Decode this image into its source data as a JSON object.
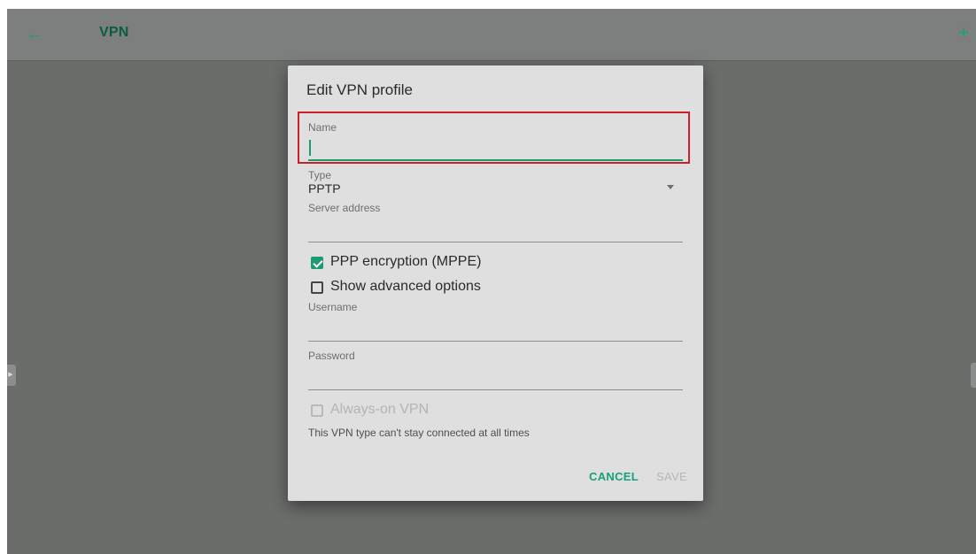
{
  "appbar": {
    "title": "VPN",
    "back_icon": "arrow-left-icon",
    "add_icon": "plus-icon",
    "back_glyph": "←",
    "add_glyph": "+"
  },
  "dialog": {
    "title": "Edit VPN profile",
    "fields": {
      "name": {
        "label": "Name",
        "value": ""
      },
      "type": {
        "label": "Type",
        "value": "PPTP"
      },
      "server_address": {
        "label": "Server address",
        "value": ""
      },
      "username": {
        "label": "Username",
        "value": ""
      },
      "password": {
        "label": "Password",
        "value": ""
      }
    },
    "checkboxes": {
      "ppp_encryption": {
        "label": "PPP encryption (MPPE)",
        "checked": true,
        "enabled": true
      },
      "show_advanced": {
        "label": "Show advanced options",
        "checked": false,
        "enabled": true
      },
      "always_on": {
        "label": "Always-on VPN",
        "checked": false,
        "enabled": false
      }
    },
    "always_on_hint": "This VPN type can't stay connected at all times",
    "buttons": {
      "cancel": "CANCEL",
      "save": "SAVE"
    }
  },
  "colors": {
    "accent": "#1a9b76",
    "highlight_border": "#c8202c",
    "scrim": "#6b6d6b",
    "dialog_bg": "#dedfde"
  }
}
